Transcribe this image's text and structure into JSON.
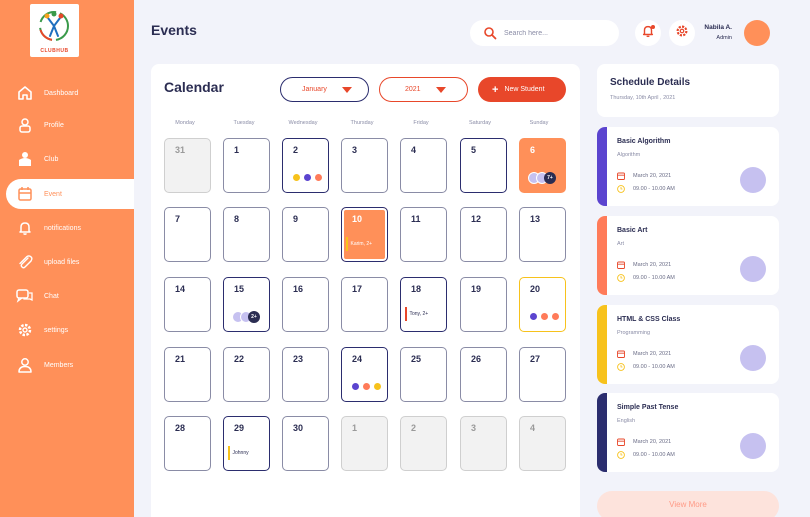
{
  "app": {
    "logo_text": "CLUBHUB",
    "accent": "#ff9059",
    "primary": "#e8472a",
    "navy": "#2b2d52"
  },
  "sidebar": {
    "items": [
      {
        "label": "Dashboard",
        "icon": "home-icon"
      },
      {
        "label": "Profile",
        "icon": "profile-icon"
      },
      {
        "label": "Club",
        "icon": "club-icon"
      },
      {
        "label": "Event",
        "icon": "calendar-icon",
        "active": true
      },
      {
        "label": "notifications",
        "icon": "bell-icon"
      },
      {
        "label": "upload files",
        "icon": "paperclip-icon"
      },
      {
        "label": "Chat",
        "icon": "chat-icon"
      },
      {
        "label": "settings",
        "icon": "gear-icon"
      },
      {
        "label": "Members",
        "icon": "members-icon"
      }
    ]
  },
  "header": {
    "title": "Events",
    "search_placeholder": "Search here...",
    "user_name": "Nabila A.",
    "user_role": "Admin"
  },
  "calendar": {
    "title": "Calendar",
    "month": "January",
    "year": "2021",
    "new_button": "New Student",
    "weekdays": [
      "Monday",
      "Tuesday",
      "Wednesday",
      "Thursday",
      "Friday",
      "Saturday",
      "Sunday"
    ],
    "days": [
      "31",
      "1",
      "2",
      "3",
      "4",
      "5",
      "6",
      "7",
      "8",
      "9",
      "10",
      "11",
      "12",
      "13",
      "14",
      "15",
      "16",
      "17",
      "18",
      "19",
      "20",
      "21",
      "22",
      "23",
      "24",
      "25",
      "26",
      "27",
      "28",
      "29",
      "30",
      "1",
      "2",
      "3",
      "4"
    ],
    "stack_counts": {
      "day6": "7+",
      "day15": "2+"
    },
    "event_tags": {
      "day10": "Karim, 2+",
      "day18": "Tony, 2+",
      "day29": "Johnny"
    }
  },
  "schedule": {
    "title": "Schedule Details",
    "date": "Thursday, 10th April , 2021",
    "cards": [
      {
        "title": "Basic Algorithm",
        "subject": "Algorithm",
        "date": "March 20, 2021",
        "time": "09.00 - 10.00 AM",
        "color": "#5b44cf"
      },
      {
        "title": "Basic Art",
        "subject": "Art",
        "date": "March 20, 2021",
        "time": "09.00 - 10.00 AM",
        "color": "#ff7b59"
      },
      {
        "title": "HTML & CSS Class",
        "subject": "Programming",
        "date": "March 20, 2021",
        "time": "09.00 - 10.00 AM",
        "color": "#f7c21c"
      },
      {
        "title": "Simple Past Tense",
        "subject": "English",
        "date": "March 20, 2021",
        "time": "09.00 - 10.00 AM",
        "color": "#2b2d6e"
      }
    ],
    "view_more": "View More"
  }
}
